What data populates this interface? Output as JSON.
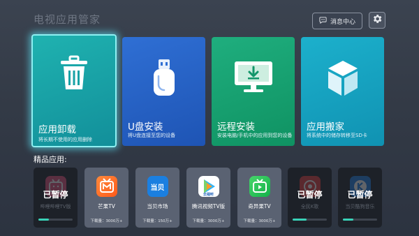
{
  "header": {
    "title": "电视应用管家",
    "message_center_label": "消息中心"
  },
  "tiles": [
    {
      "label": "应用卸载",
      "desc": "将长期不使用的应用删除"
    },
    {
      "label": "U盘安装",
      "desc": "将U盘连接至您的设备"
    },
    {
      "label": "远程安装",
      "desc": "安装电脑/手机中的应用到您的设备"
    },
    {
      "label": "应用搬家",
      "desc": "将系统中的储存转移至SD卡"
    }
  ],
  "featured_label": "精品应用:",
  "apps": [
    {
      "name": "哔哩哔哩TV版",
      "status": "已暂停",
      "progress": 0.3
    },
    {
      "name": "芒果TV",
      "downloads": "下载量：3000万+"
    },
    {
      "name": "当贝市场",
      "downloads": "下载量：150万+",
      "icon_text": "当贝"
    },
    {
      "name": "腾讯视频TV版",
      "downloads": "下载量：3000万+",
      "icon_text": "云视听"
    },
    {
      "name": "奇异果TV",
      "downloads": "下载量：3000万+"
    },
    {
      "name": "全民K歌",
      "status": "已暂停",
      "progress": 0.4
    },
    {
      "name": "当贝酷狗音乐",
      "status": "已暂停",
      "progress": 0.3
    }
  ]
}
